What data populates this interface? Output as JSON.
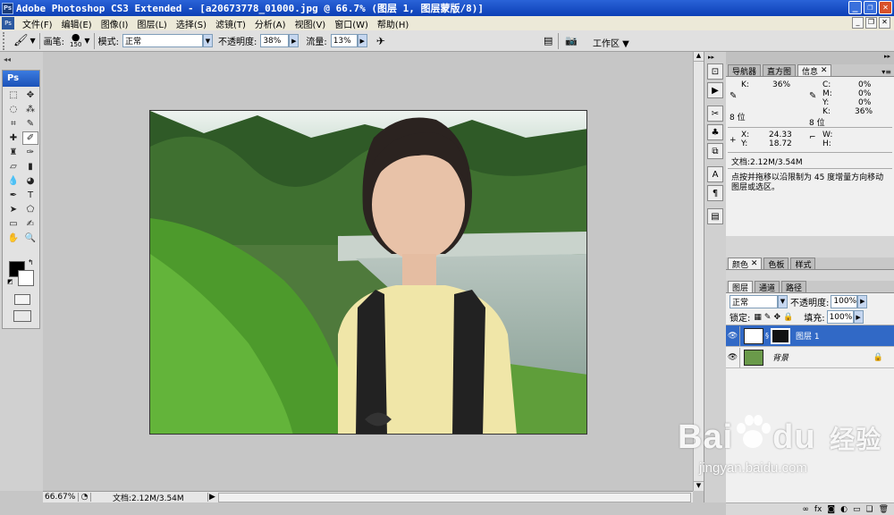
{
  "window": {
    "title": "Adobe Photoshop CS3 Extended - [a20673778_01000.jpg @ 66.7% (图层 1, 图层蒙版/8)]"
  },
  "menu": [
    "文件(F)",
    "编辑(E)",
    "图像(I)",
    "图层(L)",
    "选择(S)",
    "滤镜(T)",
    "分析(A)",
    "视图(V)",
    "窗口(W)",
    "帮助(H)"
  ],
  "options": {
    "brush_label": "画笔:",
    "brush_size": "150",
    "mode_label": "模式:",
    "mode_value": "正常",
    "opacity_label": "不透明度:",
    "opacity_value": "38%",
    "flow_label": "流量:",
    "flow_value": "13%",
    "workspace": "工作区"
  },
  "toolbox": {
    "logo": "Ps"
  },
  "info_panel": {
    "tabs": [
      "导航器",
      "直方图",
      "信息"
    ],
    "k_label": "K:",
    "k_value": "36%",
    "c_label": "C:",
    "c_value": "0%",
    "m_label": "M:",
    "m_value": "0%",
    "y_label": "Y:",
    "y_value": "0%",
    "k2_label": "K:",
    "k2_value": "36%",
    "bits1": "8 位",
    "bits2": "8 位",
    "x_label": "X:",
    "x_value": "24.33",
    "y2_label": "Y:",
    "y2_value": "18.72",
    "w_label": "W:",
    "h_label": "H:",
    "doc": "文档:2.12M/3.54M",
    "hint": "点按并拖移以沿限制为 45 度增量方向移动图层或选区。"
  },
  "color_panel": {
    "tabs": [
      "颜色",
      "色板",
      "样式"
    ]
  },
  "layers_panel": {
    "tabs": [
      "图层",
      "通道",
      "路径"
    ],
    "blend": "正常",
    "opacity_label": "不透明度:",
    "opacity_value": "100%",
    "lock_label": "锁定:",
    "fill_label": "填充:",
    "fill_value": "100%",
    "layers": [
      {
        "name": "图层 1",
        "selected": true
      },
      {
        "name": "背景",
        "selected": false
      }
    ]
  },
  "status": {
    "zoom": "66.67%",
    "doc": "文档:2.12M/3.54M"
  },
  "watermark": {
    "brand": "Bai",
    "brand2": "du",
    "cn": "经验",
    "url": "jingyan.baidu.com"
  },
  "colors": {
    "title_blue": "#0c3fb5",
    "selection_blue": "#3169c6",
    "canvas_bg": "#c6c6c6"
  }
}
